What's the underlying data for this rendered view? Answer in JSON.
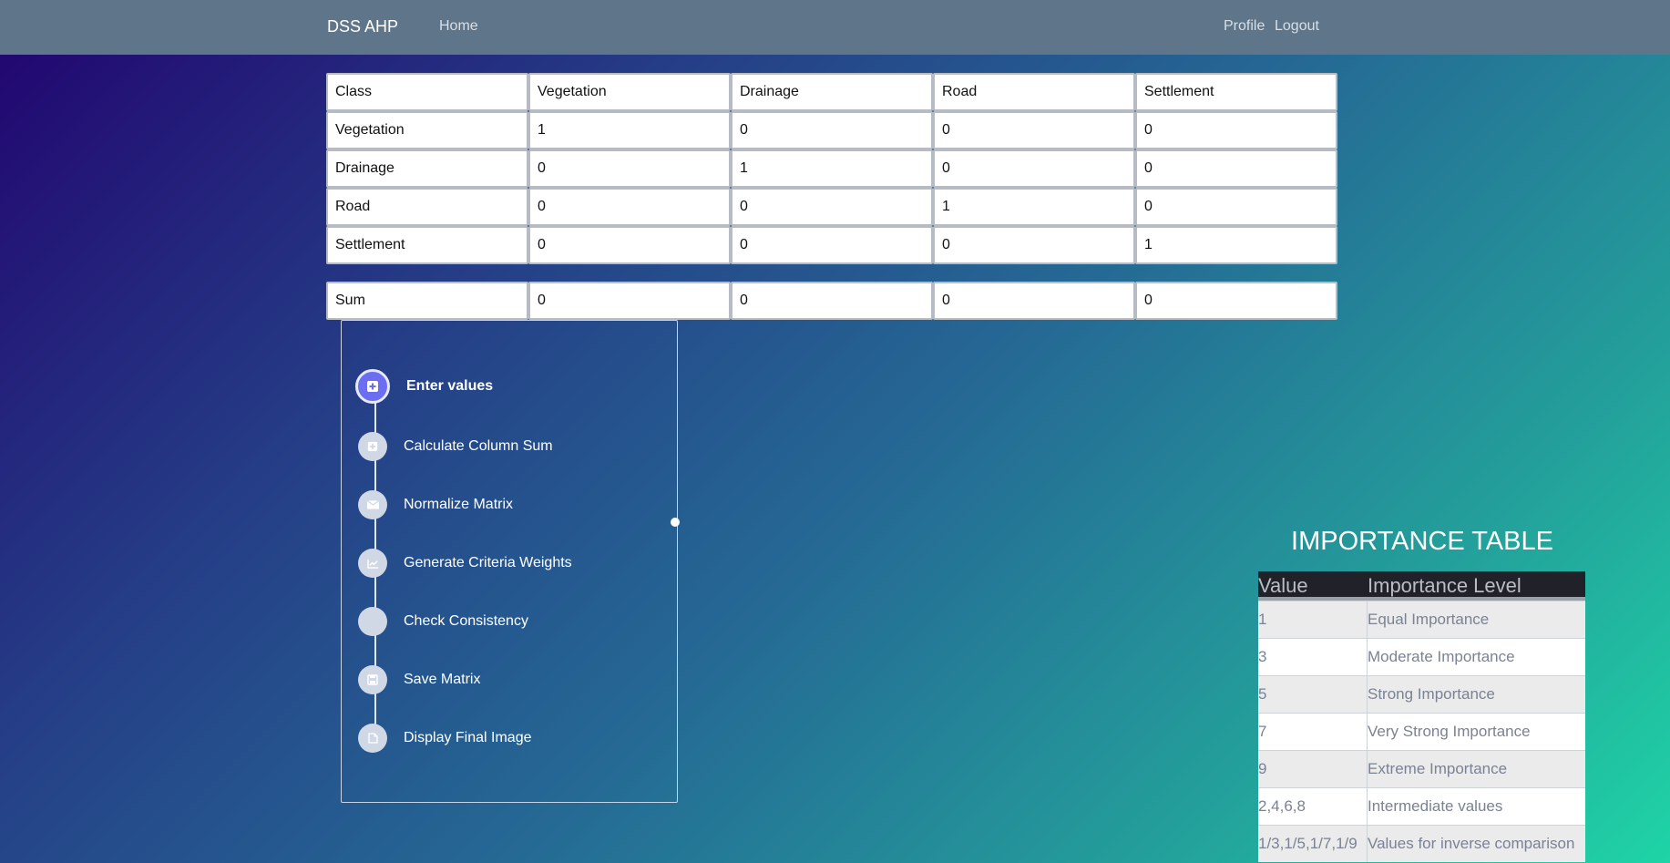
{
  "navbar": {
    "brand": "DSS AHP",
    "home": "Home",
    "profile": "Profile",
    "logout": "Logout"
  },
  "matrix": {
    "header": [
      "Class",
      "Vegetation",
      "Drainage",
      "Road",
      "Settlement"
    ],
    "rows": [
      [
        "Vegetation",
        "1",
        "0",
        "0",
        "0"
      ],
      [
        "Drainage",
        "0",
        "1",
        "0",
        "0"
      ],
      [
        "Road",
        "0",
        "0",
        "1",
        "0"
      ],
      [
        "Settlement",
        "0",
        "0",
        "0",
        "1"
      ]
    ],
    "sum": [
      "Sum",
      "0",
      "0",
      "0",
      "0"
    ]
  },
  "steps": [
    {
      "label": "Enter values",
      "icon": "plus-square-icon",
      "active": true
    },
    {
      "label": "Calculate Column Sum",
      "icon": "plus-square-icon",
      "active": false
    },
    {
      "label": "Normalize Matrix",
      "icon": "envelope-icon",
      "active": false
    },
    {
      "label": "Generate Criteria Weights",
      "icon": "chart-line-icon",
      "active": false
    },
    {
      "label": "Check Consistency",
      "icon": "blank-icon",
      "active": false
    },
    {
      "label": "Save Matrix",
      "icon": "save-icon",
      "active": false
    },
    {
      "label": "Display Final Image",
      "icon": "image-icon",
      "active": false
    }
  ],
  "importance": {
    "title": "IMPORTANCE TABLE",
    "headers": [
      "Value",
      "Importance Level"
    ],
    "rows": [
      [
        "1",
        "Equal Importance"
      ],
      [
        "3",
        "Moderate Importance"
      ],
      [
        "5",
        "Strong Importance"
      ],
      [
        "7",
        "Very Strong Importance"
      ],
      [
        "9",
        "Extreme Importance"
      ],
      [
        "2,4,6,8",
        "Intermediate values"
      ],
      [
        "1/3,1/5,1/7,1/9",
        "Values for inverse comparison"
      ]
    ]
  }
}
